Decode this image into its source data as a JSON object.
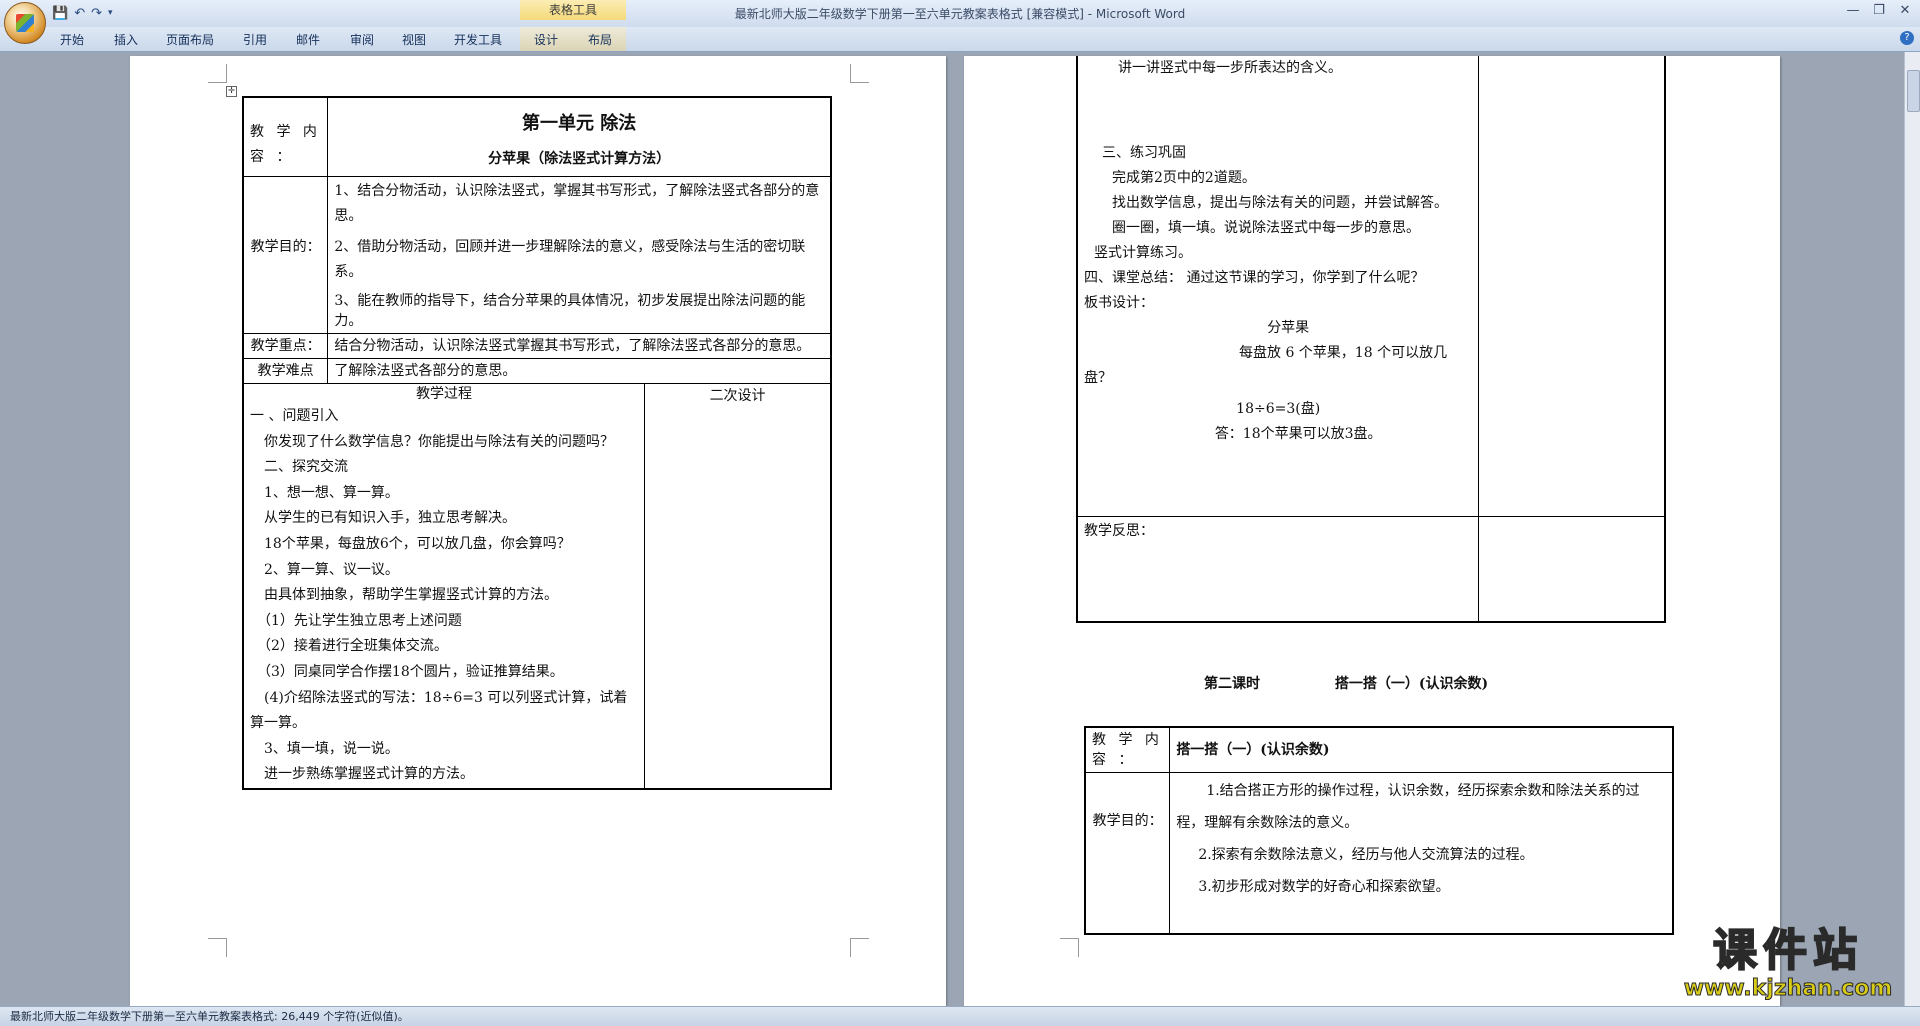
{
  "window": {
    "title": "最新北师大版二年级数学下册第一至六单元教案表格式 [兼容模式] - Microsoft Word",
    "context_tab_group": "表格工具",
    "controls": {
      "minimize": "—",
      "maximize": "❐",
      "close": "✕"
    }
  },
  "ribbon": {
    "tabs": [
      "开始",
      "插入",
      "页面布局",
      "引用",
      "邮件",
      "审阅",
      "视图",
      "开发工具",
      "设计",
      "布局"
    ]
  },
  "page1": {
    "label_content": "教 学 内 容 ：",
    "unit_title": "第一单元 除法",
    "lesson_title": "分苹果（除法竖式计算方法）",
    "label_goal": "教学目的：",
    "goals": [
      "1、结合分物活动，认识除法竖式，掌握其书写形式，了解除法竖式各部分的意思。",
      "2、借助分物活动，回顾并进一步理解除法的意义，感受除法与生活的密切联系。",
      "3、能在教师的指导下，结合分苹果的具体情况，初步发展提出除法问题的能力。"
    ],
    "label_key": "教学重点：",
    "key_point": "结合分物活动，认识除法竖式掌握其书写形式，了解除法竖式各部分的意思。",
    "label_difficult": "教学难点",
    "difficult_point": "了解除法竖式各部分的意思。",
    "process_header": "教学过程",
    "second_design_header": "二次设计",
    "process_lines": [
      "一 、问题引入",
      "　你发现了什么数学信息？你能提出与除法有关的问题吗？",
      "　二、探究交流",
      "　1、想一想、算一算。",
      "　从学生的已有知识入手，独立思考解决。",
      "　18个苹果，每盘放6个，可以放几盘，你会算吗？",
      "　2、算一算、议一议。",
      "　由具体到抽象，帮助学生掌握竖式计算的方法。",
      "　（1）先让学生独立思考上述问题",
      "　（2）接着进行全班集体交流。",
      "　（3）同桌同学合作摆18个圆片，验证推算结果。",
      "　(4)介绍除法竖式的写法：18÷6=3 可以列竖式计算，试着算一算。",
      "　3、填一填，说一说。",
      "　进一步熟练掌握竖式计算的方法。"
    ]
  },
  "page2": {
    "process_lines": [
      "讲一讲竖式中每一步所表达的含义。",
      "",
      "三、练习巩固",
      "完成第2页中的2道题。",
      "找出数学信息，提出与除法有关的问题，并尝试解答。",
      "圈一圈，填一填。说说除法竖式中每一步的意思。",
      "竖式计算练习。",
      "四、课堂总结： 通过这节课的学习，你学到了什么呢？",
      "板书设计："
    ],
    "board": {
      "title": "分苹果",
      "question": "每盘放 6 个苹果，18 个可以放几盘？",
      "equation": "18÷6=3(盘)",
      "answer": "答：18个苹果可以放3盘。"
    },
    "label_reflection": "教学反思：",
    "lesson2_heading_a": "第二课时",
    "lesson2_heading_b": "搭一搭（一）(认识余数)",
    "t2_label_content": "教 学 内 容 ：",
    "t2_title": "搭一搭（一）(认识余数)",
    "t2_label_goal": "教学目的：",
    "t2_goals": [
      "1.结合搭正方形的操作过程，认识余数，经历探索余数和除法关系的过程，理解有余数除法的意义。",
      "2.探索有余数除法意义，经历与他人交流算法的过程。",
      "3.初步形成对数学的好奇心和探索欲望。"
    ]
  },
  "statusbar": {
    "text": "最新北师大版二年级数学下册第一至六单元教案表格式: 26,449 个字符(近似值)。"
  },
  "watermark": {
    "title": "课件站",
    "url": "www.kjzhan.com"
  },
  "icons": [
    "office-button-icon",
    "save-icon",
    "undo-icon",
    "redo-icon",
    "qat-dropdown-icon",
    "help-icon",
    "table-move-handle-icon"
  ]
}
